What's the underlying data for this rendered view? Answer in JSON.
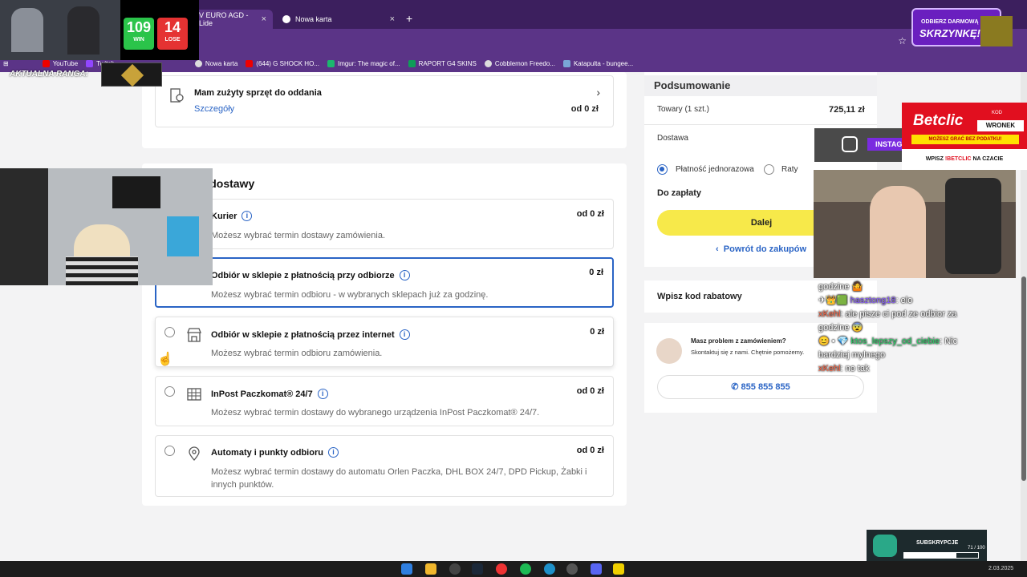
{
  "browser": {
    "tabs": [
      {
        "label": "V EURO AGD - Lide"
      },
      {
        "label": "Nowa karta"
      }
    ],
    "bookmarks": [
      "YouTube",
      "Twitch",
      "",
      "Nowa karta",
      "(644) G SHOCK HO...",
      "Imgur: The magic of...",
      "RAPORT G4 SKINS",
      "Cobblemon Freedo...",
      "Katapulta - bungee..."
    ]
  },
  "overlay_stream": {
    "win_count": "109",
    "win_label": "WIN",
    "lose_count": "14",
    "lose_label": "LOSE",
    "rank_label": "AKTUALNA RANGA:",
    "promo_top": "ODBIERZ DARMOWĄ",
    "promo_main": "SKRZYNKĘ!",
    "betclic_brand": "Betclic",
    "betclic_code_label": "KOD",
    "betclic_code": "WRONEK",
    "betclic_tagline": "MOŻESZ GRAĆ BEZ PODATKU!",
    "betclic_write": "WPISZ",
    "betclic_write2": "!BETCLIC",
    "betclic_write3": "NA CZACIE",
    "insta_label": "INSTAG",
    "subs_label": "SUBSKRYPCJE",
    "subs_progress": "71 / 100",
    "subs_fraction": 0.71
  },
  "chat": [
    {
      "user": "",
      "text": "godzine 🤷"
    },
    {
      "user": "hasztong18",
      "text": ": elo"
    },
    {
      "user": "xKehl",
      "text": ": ale pisze ci pod ze odbior za godzine 😨"
    },
    {
      "user": "ktos_lepszy_od_ciebie",
      "text": ": Nic bardziej mylnego"
    },
    {
      "user": "xKehl",
      "text": ": no tak"
    }
  ],
  "recycle": {
    "title": "Mam zużyty sprzęt do oddania",
    "link": "Szczegóły",
    "price": "od 0 zł"
  },
  "delivery": {
    "heading": "Sposób dostawy",
    "options": [
      {
        "title": "Kurier",
        "desc": "Możesz wybrać termin dostawy zamówienia.",
        "price": "od 0 zł"
      },
      {
        "title": "Odbiór w sklepie z płatnością przy odbiorze",
        "desc": "Możesz wybrać termin odbioru - w wybranych sklepach już za godzinę.",
        "price": "0 zł"
      },
      {
        "title": "Odbiór w sklepie z płatnością przez internet",
        "desc": "Możesz wybrać termin odbioru zamówienia.",
        "price": "0 zł"
      },
      {
        "title": "InPost Paczkomat® 24/7",
        "desc": "Możesz wybrać termin dostawy do wybranego urządzenia InPost Paczkomat® 24/7.",
        "price": "od 0 zł"
      },
      {
        "title": "Automaty i punkty odbioru",
        "desc": "Możesz wybrać termin dostawy do automatu Orlen Paczka, DHL BOX 24/7, DPD Pickup, Żabki i innych punktów.",
        "price": "od 0 zł"
      }
    ]
  },
  "summary": {
    "heading": "Podsumowanie",
    "goods_label": "Towary (1 szt.)",
    "goods_value": "725,11 zł",
    "shipping_label": "Dostawa",
    "pay_once": "Płatność jednorazowa",
    "installments": "Raty",
    "to_pay": "Do zapłaty",
    "next_button": "Dalej",
    "back_link": "Powrót do zakupów"
  },
  "discount": {
    "label": "Wpisz kod rabatowy"
  },
  "help": {
    "title": "Masz problem z zamówieniem?",
    "subtitle": "Skontaktuj się z nami. Chętnie pomożemy.",
    "phone": "855 855 855"
  },
  "taskbar": {
    "date": "2.03.2025"
  },
  "colors": {
    "accent_blue": "#2a64c5",
    "yellow_button": "#f7e94a",
    "browser_purple": "#5b3487"
  }
}
